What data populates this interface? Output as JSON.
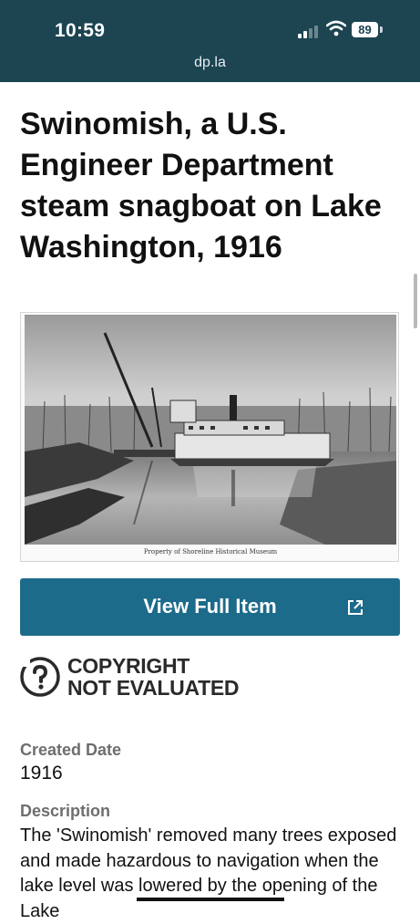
{
  "status_bar": {
    "time": "10:59",
    "battery": "89",
    "url": "dp.la"
  },
  "item": {
    "title": "Swinomish, a U.S. Engineer Department steam snagboat on Lake Washington, 1916",
    "image_caption": "Property of Shoreline Historical Museum",
    "view_button_label": "View Full Item",
    "rights_line1": "COPYRIGHT",
    "rights_line2": "NOT EVALUATED"
  },
  "metadata": {
    "created_label": "Created Date",
    "created_value": "1916",
    "description_label": "Description",
    "description_value": "The 'Swinomish' removed many trees exposed and made hazardous to navigation when the lake level was lowered by the opening of the Lake"
  },
  "icons": {
    "signal": "signal-icon",
    "wifi": "wifi-icon",
    "battery": "battery-icon",
    "external_link": "external-link-icon",
    "rights": "question-mark-icon"
  },
  "colors": {
    "status_bar_bg": "#1c4451",
    "button_bg": "#1d6b8b",
    "label_gray": "#6e6e6e"
  }
}
